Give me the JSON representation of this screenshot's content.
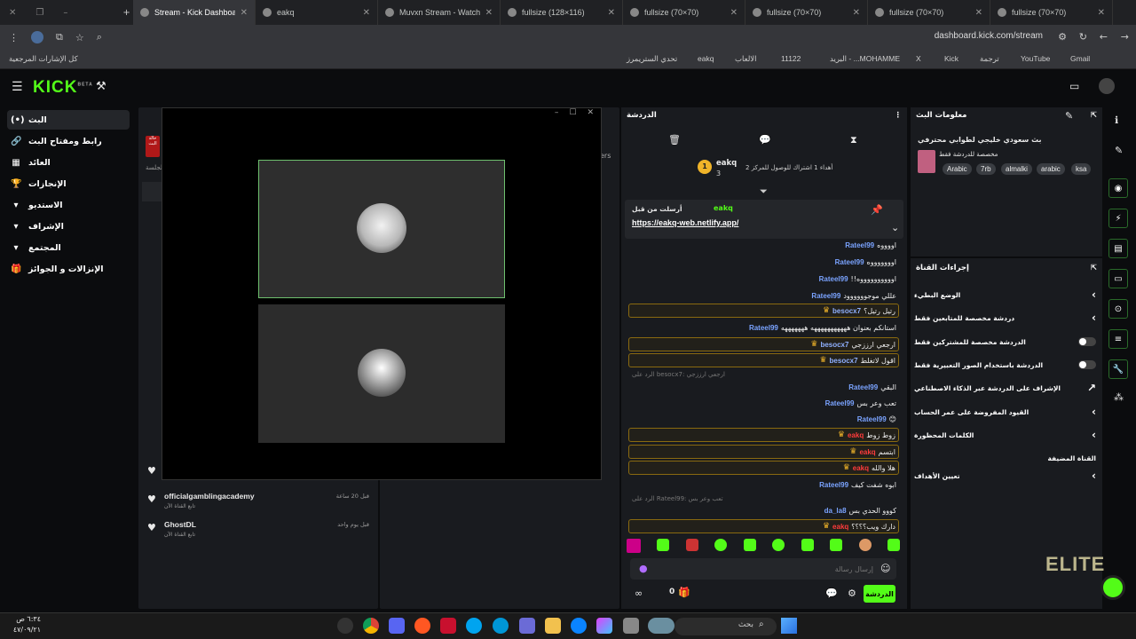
{
  "tabs": [
    {
      "label": "fullsize (70×70)"
    },
    {
      "label": "fullsize (70×70)"
    },
    {
      "label": "fullsize (70×70)"
    },
    {
      "label": "fullsize (70×70)"
    },
    {
      "label": "fullsize (128×116)"
    },
    {
      "label": "Muvxn Stream - Watch Li"
    },
    {
      "label": "eakq"
    },
    {
      "label": "Stream - Kick Dashboard"
    }
  ],
  "address": {
    "url": "dashboard.kick.com/stream"
  },
  "bookmarks": {
    "all": "كل الإشارات المرجعية",
    "items": [
      "Gmail",
      "YouTube",
      "ترجمة",
      "Kick",
      "X",
      "البريد - ...MOHAMME",
      "11122",
      "الالعاب",
      "eakq",
      "تحدي الستريمرز"
    ]
  },
  "kick": {
    "logo": "KICK",
    "beta": "BETA"
  },
  "sidebar": {
    "items": [
      {
        "label": "البث",
        "icon": "(•)"
      },
      {
        "label": "رابط ومفتاح البث",
        "icon": "🔗"
      },
      {
        "label": "العائد",
        "icon": "▦"
      },
      {
        "label": "الإنجازات",
        "icon": "🏆"
      },
      {
        "label": "الاستديو",
        "icon": "▾"
      },
      {
        "label": "الإشراف",
        "icon": "▾"
      },
      {
        "label": "المجتمع",
        "icon": "▾"
      },
      {
        "label": "الإنزالات و الجوائز",
        "icon": "🎁"
      }
    ]
  },
  "activity": {
    "items": [
      {
        "name": "officialgamblingacademy",
        "sub": "تابع القناة الآن",
        "time": "قبل 20 ساعة"
      },
      {
        "name": "GhostDL",
        "sub": "تابع القناة الآن",
        "time": "قبل يوم واحد"
      }
    ],
    "live_badge": "حالة البث",
    "session": "الجلسة",
    "ers": "ers"
  },
  "chat": {
    "title": "الدردشة",
    "leader": {
      "name": "eakq",
      "count": "3",
      "rank": "1",
      "note": "أهداء 1 اشتراك للوصول للمركز 2"
    },
    "pinned": {
      "by": "أرسلت من قبل",
      "user": "eakq",
      "link": "https://eakq-web.netlify.app/"
    },
    "messages": [
      {
        "user": "Rateel99",
        "text": "اووووه",
        "hl": false
      },
      {
        "user": "Rateel99",
        "text": "اوووووووه",
        "hl": false
      },
      {
        "user": "Rateel99",
        "text": "اووووووووووه!!",
        "hl": false
      },
      {
        "user": "Rateel99",
        "text": "عللي موجوووووود",
        "hl": false
      },
      {
        "user": "besocx7",
        "text": "رتيل رتيل؟",
        "hl": true
      },
      {
        "user": "Rateel99",
        "text": "استانكم بعنوان هههههههههههه هههههههه",
        "hl": false
      },
      {
        "user": "besocx7",
        "text": "ارجعي ارززجي",
        "hl": true
      },
      {
        "user": "besocx7",
        "text": "اقول لاتغلط",
        "hl": true
      },
      {
        "user": "Rateel99",
        "text": "البقي",
        "hl": false
      },
      {
        "user": "Rateel99",
        "text": "تعب وعر بس",
        "hl": false
      },
      {
        "user": "Rateel99",
        "text": "😊",
        "hl": false
      },
      {
        "user": "eakq",
        "text": "زوط زوط",
        "hl": true
      },
      {
        "user": "eakq",
        "text": "ابتسم",
        "hl": true
      },
      {
        "user": "eakq",
        "text": "هلا والله",
        "hl": true
      },
      {
        "user": "Rateel99",
        "text": "ابوه شفت كيف",
        "hl": false
      },
      {
        "user": "da_la8",
        "text": "كووو الحدي بس",
        "hl": false
      },
      {
        "user": "eakq",
        "text": "دارك ويب؟؟؟؟",
        "hl": true
      }
    ],
    "reply1": "الرد على besocx7: ارجعي ارززجي",
    "reply2": "الرد على Rateel99: تعب وعر بس",
    "placeholder": "إرسال رسالة",
    "send": "الدردشة",
    "points": "0"
  },
  "info": {
    "title": "معلومات البث",
    "stream_title": "بث سعودي خليجي لطوابي محترفي",
    "category": "مخصصة للدردشة فقط",
    "tags": [
      "Arabic",
      "7rb",
      "almalki",
      "arabic",
      "ksa"
    ],
    "actions_title": "إجراءات القناة",
    "options": [
      {
        "label": "الوضع البطيء",
        "ctl": "›"
      },
      {
        "label": "دردشة مخصصة للمتابعين فقط",
        "ctl": "›"
      },
      {
        "label": "الدردشة مخصصة للمشتركين فقط",
        "ctl": "toggle"
      },
      {
        "label": "الدردشة باستخدام الصور التعبيرية فقط",
        "ctl": "toggle"
      },
      {
        "label": "الإشراف على الدردشة عبر الذكاء الاصطناعي",
        "ctl": "↗"
      },
      {
        "label": "القيود المفروضة على عمر الحساب",
        "ctl": "›"
      },
      {
        "label": "الكلمات المحظورة",
        "ctl": "›"
      },
      {
        "label": "القناة المضيفة",
        "ctl": ""
      },
      {
        "label": "تعيين الأهداف",
        "ctl": "›"
      }
    ]
  },
  "taskbar": {
    "time": "٦:٣٤ ص",
    "date": "٤٧/٠٩/٢١",
    "search": "بحث"
  },
  "watermark": "ELITE"
}
